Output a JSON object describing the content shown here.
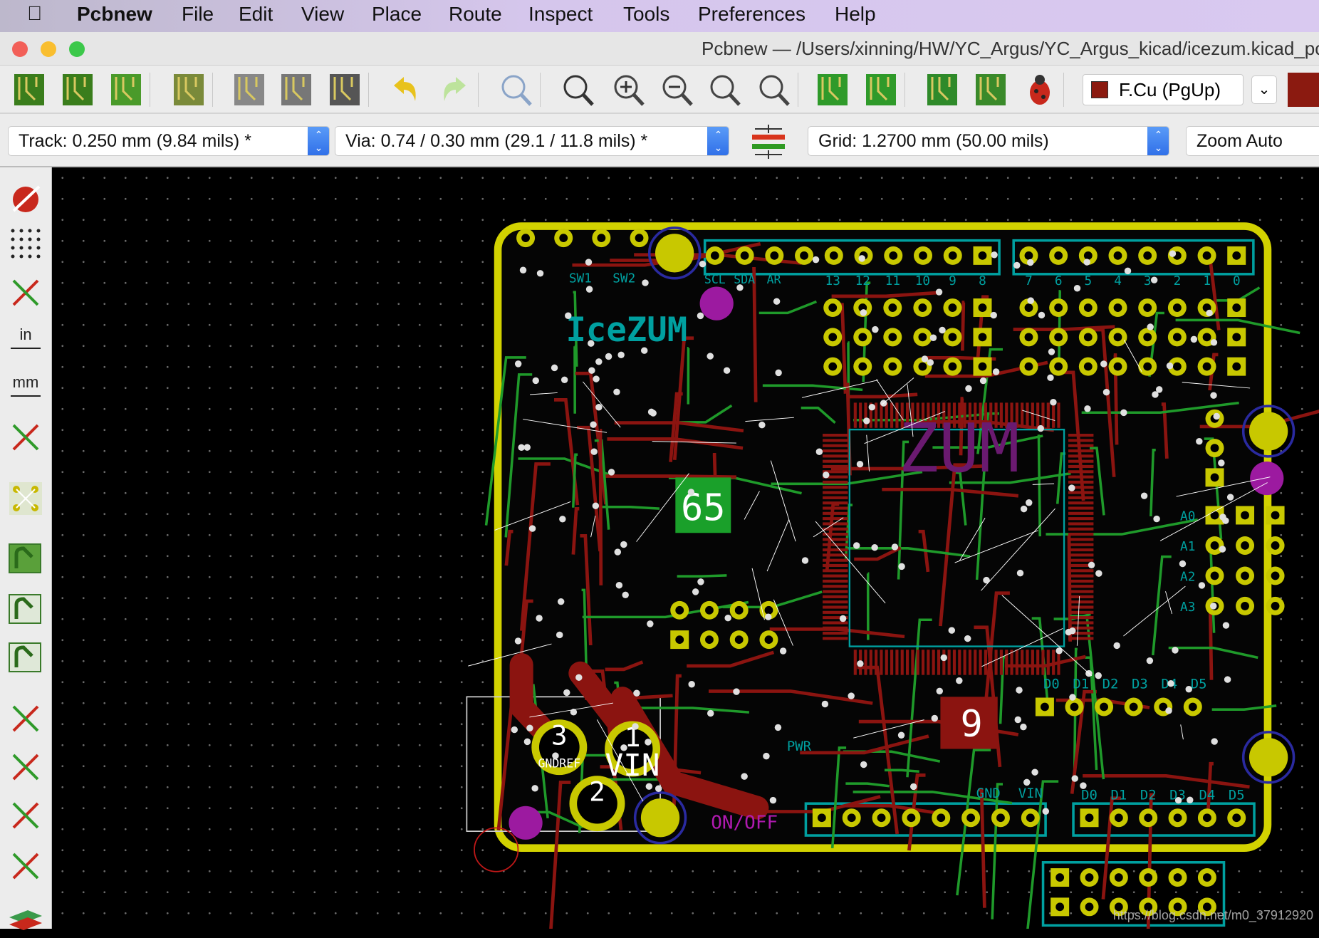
{
  "menubar": {
    "app": "Pcbnew",
    "items": [
      "File",
      "Edit",
      "View",
      "Place",
      "Route",
      "Inspect",
      "Tools",
      "Preferences",
      "Help"
    ]
  },
  "window": {
    "title": "Pcbnew — /Users/xinning/HW/YC_Argus/YC_Argus_kicad/icezum.kicad_pcb"
  },
  "toolbar": {
    "icons": [
      "pcb-new-icon",
      "pcb-open-icon",
      "save-icon",
      "board-setup-icon",
      "page-settings-icon",
      "print-icon",
      "plot-icon",
      "undo-icon",
      "redo-icon",
      "find-icon",
      "redraw-icon",
      "zoom-in-icon",
      "zoom-out-icon",
      "zoom-fit-icon",
      "zoom-selection-icon",
      "footprint-editor-icon",
      "footprint-browser-icon",
      "netlist-icon",
      "update-pcb-icon",
      "drc-bug-icon"
    ],
    "layer_select": "F.Cu (PgUp)",
    "layer_color": "#8b1a10"
  },
  "toolbar2": {
    "track": "Track: 0.250 mm (9.84 mils) *",
    "via": "Via: 0.74 / 0.30 mm (29.1 / 11.8 mils) *",
    "grid": "Grid: 1.2700 mm (50.00 mils)",
    "zoom": "Zoom Auto"
  },
  "left_toolbar": [
    "drc-off-icon",
    "grid-toggle-icon",
    "polar-coords-icon",
    "units-inch-icon",
    "units-mm-icon",
    "cursor-shape-icon",
    "ratsnest-icon",
    "zone-fill-icon",
    "zone-outline-icon",
    "zone-sketch-icon",
    "via-sketch-icon",
    "track-sketch-icon",
    "high-contrast-icon",
    "microwave-icon",
    "layers-manager-icon"
  ],
  "pcb": {
    "labels": {
      "chip_a": "65",
      "chip_b": "9",
      "term1": "1",
      "term1b": "VIN",
      "term2": "2",
      "term3": "3",
      "gndref": "GNDREF",
      "logo": "IceZUM",
      "pwr": "PWR",
      "onoff": "ON/OFF",
      "gnd": "GND",
      "vin": "VIN",
      "sw1": "SW1",
      "sw2": "SW2",
      "scl": "SCL",
      "sda": "SDA",
      "ar": "AR",
      "digital_top": [
        "13",
        "12",
        "11",
        "10",
        "9",
        "8",
        "7",
        "6",
        "5",
        "4",
        "3",
        "2",
        "1",
        "0"
      ],
      "digital_bottom": [
        "D0",
        "D1",
        "D2",
        "D3",
        "D4",
        "D5"
      ],
      "analog": [
        "A0",
        "A1",
        "A2",
        "A3"
      ]
    },
    "colors": {
      "edge": "#d2d200",
      "front_cu": "#8b1410",
      "back_cu": "#1f9a2a",
      "silk": "#00a0a0",
      "via": "#9c1aa0",
      "pad": "#c8c800"
    }
  },
  "watermark": "https://blog.csdn.net/m0_37912920"
}
